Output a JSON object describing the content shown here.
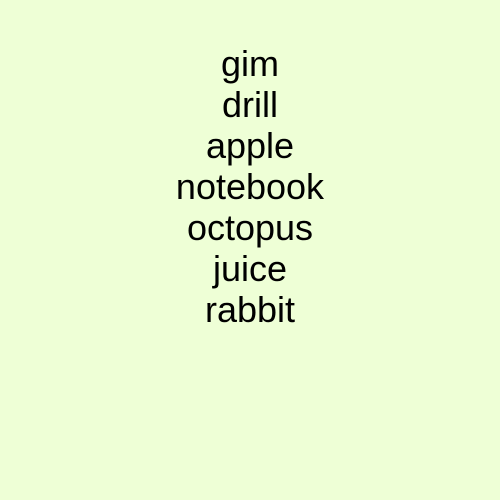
{
  "words": [
    "gim",
    "drill",
    "apple",
    "notebook",
    "octopus",
    "juice",
    "rabbit"
  ],
  "colors": {
    "background": "#eeffd6",
    "text": "#000000"
  }
}
